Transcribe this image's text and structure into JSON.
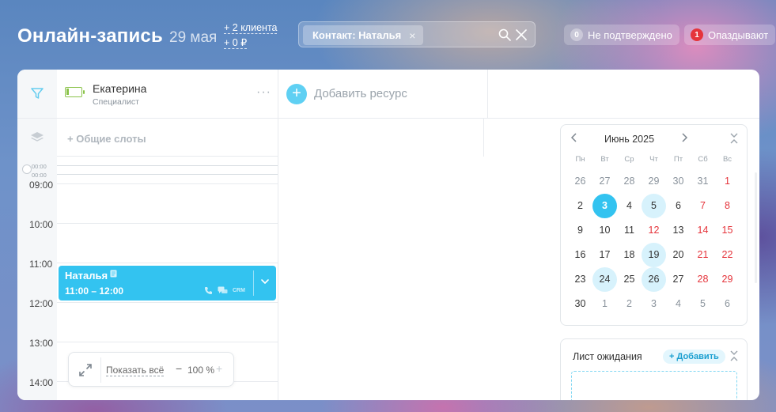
{
  "header": {
    "title": "Онлайн-запись",
    "date": "29 мая",
    "clients": "+ 2 клиента",
    "amount": "+ 0 ₽"
  },
  "search": {
    "chip_label": "Контакт: Наталья",
    "chip_remove": "×"
  },
  "status": {
    "unconfirmed_count": "0",
    "unconfirmed_label": "Не подтверждено",
    "late_count": "1",
    "late_label": "Опаздывают"
  },
  "resource": {
    "name": "Екатерина",
    "role": "Специалист",
    "menu": "···"
  },
  "add_resource": {
    "icon": "+",
    "label": "Добавить ресурс"
  },
  "slots": {
    "label": "+ Общие слоты"
  },
  "timeline": {
    "mini_labels": [
      "00:00",
      "00:00"
    ],
    "hours": [
      "09:00",
      "10:00",
      "11:00",
      "12:00",
      "13:00",
      "14:00"
    ]
  },
  "appointment": {
    "name": "Наталья",
    "time": "11:00 – 12:00",
    "crm": "CRM",
    "color": "#33c3f0"
  },
  "zoom": {
    "show_all": "Показать всё",
    "minus": "−",
    "value": "100 %",
    "plus": "+"
  },
  "calendar": {
    "title": "Июнь 2025",
    "weekdays": [
      "Пн",
      "Вт",
      "Ср",
      "Чт",
      "Пт",
      "Сб",
      "Вс"
    ],
    "weeks": [
      [
        "26",
        "27",
        "28",
        "29",
        "30",
        "31",
        "1"
      ],
      [
        "2",
        "3",
        "4",
        "5",
        "6",
        "7",
        "8"
      ],
      [
        "9",
        "10",
        "11",
        "12",
        "13",
        "14",
        "15"
      ],
      [
        "16",
        "17",
        "18",
        "19",
        "20",
        "21",
        "22"
      ],
      [
        "23",
        "24",
        "25",
        "26",
        "27",
        "28",
        "29"
      ],
      [
        "30",
        "1",
        "2",
        "3",
        "4",
        "5",
        "6"
      ]
    ],
    "selected": "3",
    "marked": [
      "5",
      "19",
      "24",
      "26"
    ],
    "red_days": [
      "12"
    ],
    "accent": "#33c3f0"
  },
  "waitlist": {
    "title": "Лист ожидания",
    "add_label": "+ Добавить"
  }
}
